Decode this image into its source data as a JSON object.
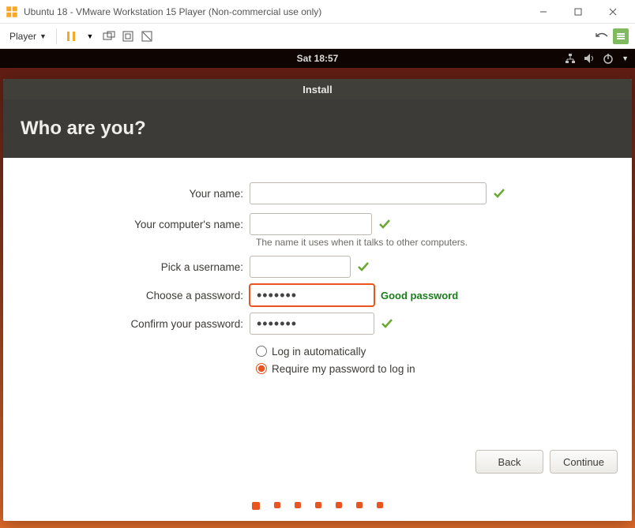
{
  "vmware": {
    "title": "Ubuntu 18 - VMware Workstation 15 Player (Non-commercial use only)",
    "player_label": "Player"
  },
  "topbar": {
    "clock": "Sat 18:57"
  },
  "installer": {
    "title": "Install",
    "heading": "Who are you?",
    "labels": {
      "your_name": "Your name:",
      "computer_name": "Your computer's name:",
      "computer_hint": "The name it uses when it talks to other computers.",
      "username": "Pick a username:",
      "password": "Choose a password:",
      "confirm": "Confirm your password:",
      "login_auto": "Log in automatically",
      "login_require": "Require my password to log in",
      "password_strength": "Good password"
    },
    "values": {
      "your_name": "",
      "computer_name": "",
      "username": "",
      "password": "•••••••",
      "confirm": "•••••••",
      "login_mode": "require"
    },
    "buttons": {
      "back": "Back",
      "continue": "Continue"
    },
    "progress_steps": 7,
    "progress_current": 1
  }
}
